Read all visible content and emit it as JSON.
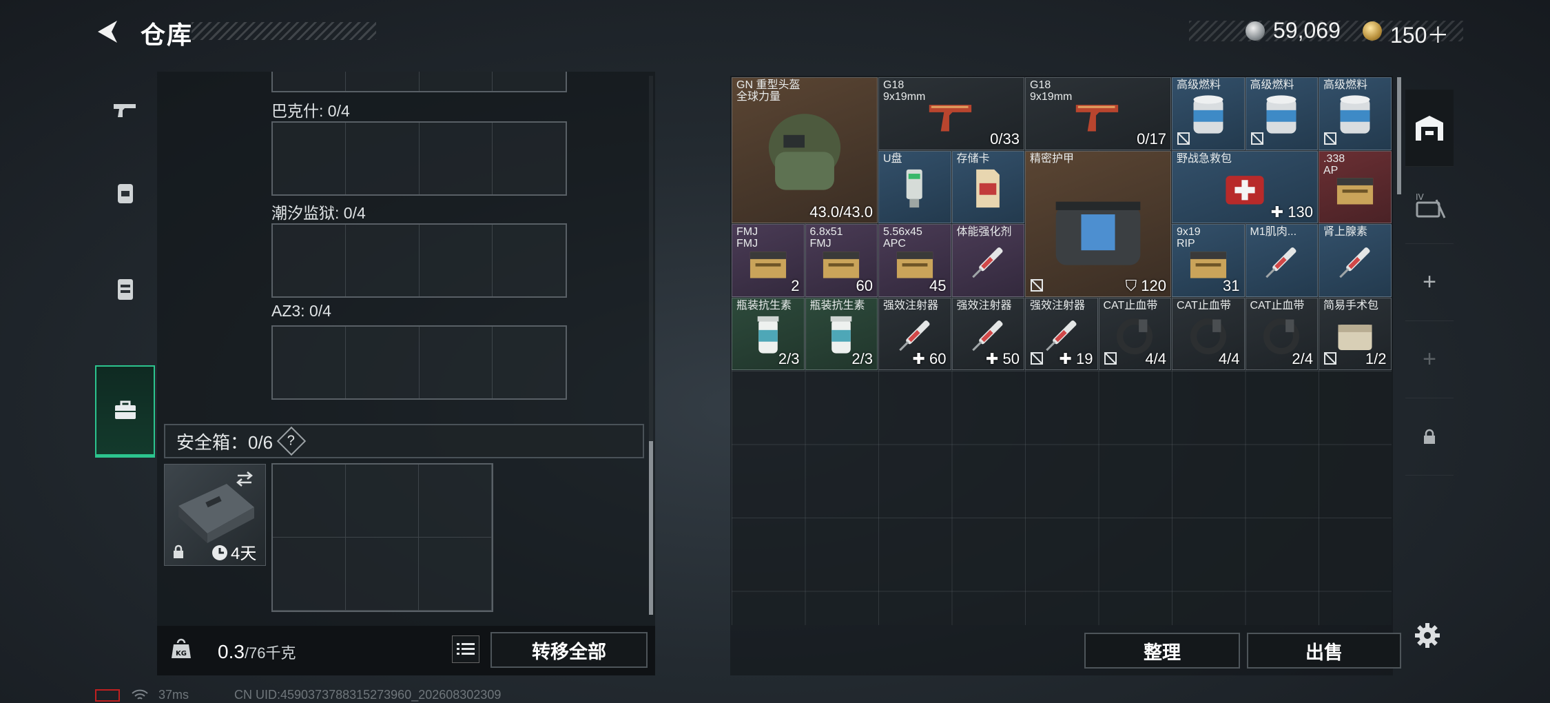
{
  "header": {
    "title": "仓库",
    "silver": "59,069",
    "gold": "150＋"
  },
  "left": {
    "slots": [
      {
        "label": "巴克什: 0/4"
      },
      {
        "label": "潮汐监狱: 0/4"
      },
      {
        "label": "AZ3: 0/4"
      }
    ],
    "safe": {
      "label": "安全箱：0/6",
      "help": "?",
      "days": "4天"
    },
    "weight": {
      "value": "0.3",
      "capacity": "/76千克"
    },
    "transfer_all": "转移全部"
  },
  "items": [
    {
      "name": "GN 重型头盔\n全球力量",
      "count": "43.0/43.0",
      "bg": "brown",
      "icon": "helmet-icon"
    },
    {
      "name": "G18\n9x19mm",
      "count": "0/33",
      "bg": "dark",
      "icon": "pistol-icon"
    },
    {
      "name": "G18\n9x19mm",
      "count": "0/17",
      "bg": "dark",
      "icon": "pistol-icon"
    },
    {
      "name": "高级燃料",
      "count": "",
      "bg": "blue",
      "icon": "fuel-can-icon",
      "nosale": true
    },
    {
      "name": "高级燃料",
      "count": "",
      "bg": "blue",
      "icon": "fuel-can-icon",
      "nosale": true
    },
    {
      "name": "高级燃料",
      "count": "",
      "bg": "blue",
      "icon": "fuel-can-icon",
      "nosale": true
    },
    {
      "name": "U盘",
      "count": "",
      "bg": "blue",
      "icon": "usb-drive-icon"
    },
    {
      "name": "存储卡",
      "count": "",
      "bg": "blue",
      "icon": "memory-card-icon"
    },
    {
      "name": "精密护甲",
      "count": "120",
      "bg": "brown",
      "icon": "armor-bag-icon",
      "nosale": true,
      "armor": true
    },
    {
      "name": "野战急救包",
      "count": "130",
      "bg": "blue",
      "icon": "medkit-icon",
      "plus": true
    },
    {
      "name": ".338\nAP",
      "count": "",
      "bg": "red",
      "icon": "ammo-box-icon"
    },
    {
      "name": "FMJ\nFMJ",
      "count": "2",
      "bg": "purple",
      "icon": "ammo-box-icon"
    },
    {
      "name": "6.8x51\nFMJ",
      "count": "60",
      "bg": "purple",
      "icon": "ammo-box-icon"
    },
    {
      "name": "5.56x45\nAPC",
      "count": "45",
      "bg": "purple",
      "icon": "ammo-box-icon"
    },
    {
      "name": "体能强化剂",
      "count": "",
      "bg": "purple",
      "icon": "syringe-icon"
    },
    {
      "name": "9x19\nRIP",
      "count": "31",
      "bg": "blue",
      "icon": "ammo-box-icon"
    },
    {
      "name": "M1肌肉...",
      "count": "",
      "bg": "blue",
      "icon": "syringe-icon"
    },
    {
      "name": "肾上腺素",
      "count": "",
      "bg": "blue",
      "icon": "syringe-icon"
    },
    {
      "name": "瓶装抗生素",
      "count": "2/3",
      "bg": "green",
      "icon": "pill-bottle-icon"
    },
    {
      "name": "瓶装抗生素",
      "count": "2/3",
      "bg": "green",
      "icon": "pill-bottle-icon"
    },
    {
      "name": "强效注射器",
      "count": "60",
      "bg": "dark",
      "icon": "syringe-icon",
      "plus": true
    },
    {
      "name": "强效注射器",
      "count": "50",
      "bg": "dark",
      "icon": "syringe-icon",
      "plus": true
    },
    {
      "name": "强效注射器",
      "count": "19",
      "bg": "dark",
      "icon": "syringe-icon",
      "plus": true,
      "nosale": true
    },
    {
      "name": "CAT止血带",
      "count": "4/4",
      "bg": "dark",
      "icon": "tourniquet-icon",
      "nosale": true
    },
    {
      "name": "CAT止血带",
      "count": "4/4",
      "bg": "dark",
      "icon": "tourniquet-icon"
    },
    {
      "name": "CAT止血带",
      "count": "2/4",
      "bg": "dark",
      "icon": "tourniquet-icon"
    },
    {
      "name": "简易手术包",
      "count": "1/2",
      "bg": "dark",
      "icon": "surgery-kit-icon",
      "nosale": true
    }
  ],
  "buttons": {
    "organize": "整理",
    "sell": "出售"
  },
  "footer": {
    "ping": "37ms",
    "uid": "CN UID:4590373788315273960_202608302309"
  },
  "colors": {
    "accent": "#2cc48e"
  }
}
